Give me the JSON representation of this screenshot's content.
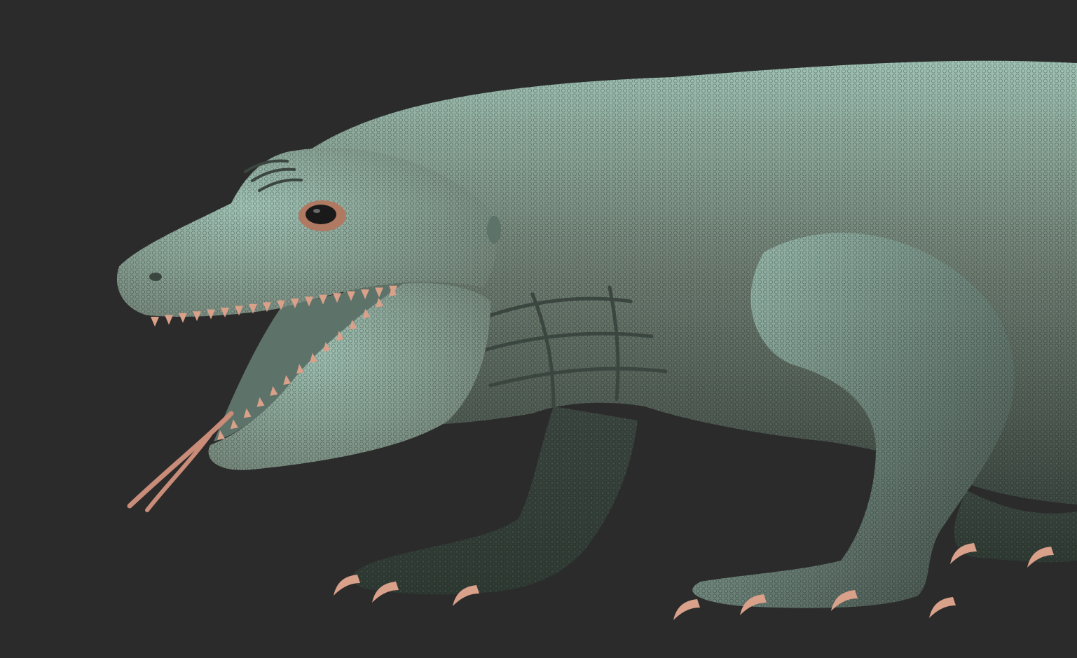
{
  "scene": {
    "background_color": "#2b2b2b",
    "subject": "lizard",
    "material_colors": {
      "skin_base": "#6f7e72",
      "skin_highlight": "#9fc2b4",
      "skin_shadow": "#3c4640",
      "rim_copper": "#b07a62",
      "teeth_claws": "#d9a08a",
      "tongue": "#c98c78",
      "eye": "#1a1a1a",
      "mouth_interior": "#5d7268"
    }
  }
}
